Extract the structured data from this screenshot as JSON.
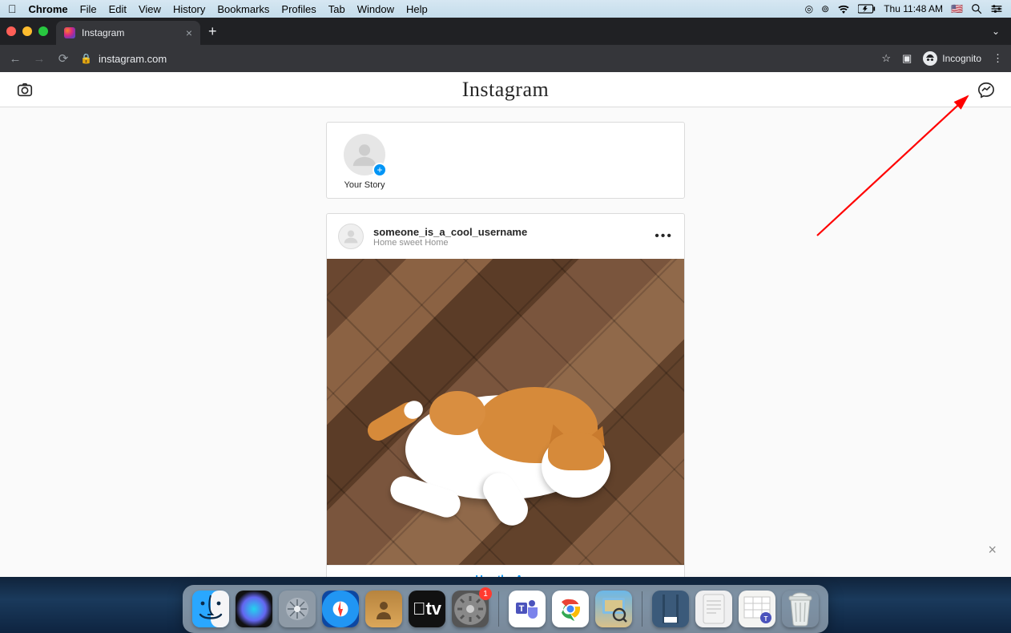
{
  "mac_menu": {
    "app": "Chrome",
    "items": [
      "File",
      "Edit",
      "View",
      "History",
      "Bookmarks",
      "Profiles",
      "Tab",
      "Window",
      "Help"
    ],
    "clock": "Thu 11:48 AM"
  },
  "browser": {
    "tab_title": "Instagram",
    "url": "instagram.com",
    "incognito_label": "Incognito"
  },
  "instagram": {
    "logo_text": "Instagram",
    "story_label": "Your Story",
    "post": {
      "username": "someone_is_a_cool_username",
      "location": "Home sweet Home",
      "image_alt": "orange and white cat lying on wooden floor"
    },
    "use_app": "Use the App"
  },
  "dock": {
    "badge_settings": "1",
    "appletv_label": "tv"
  }
}
